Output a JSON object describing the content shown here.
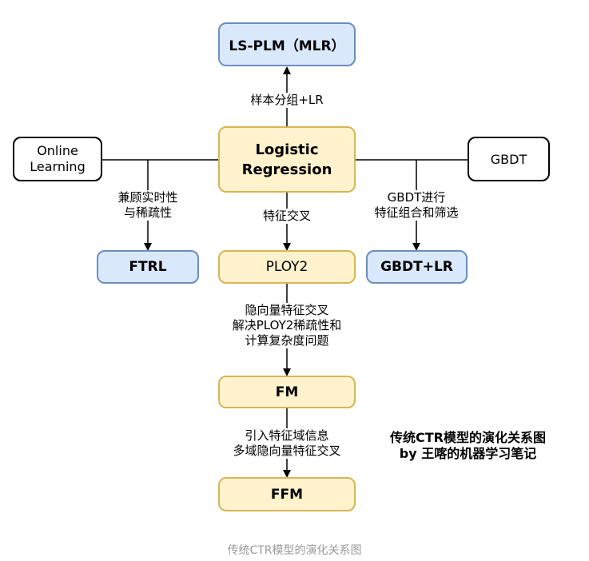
{
  "nodes": {
    "ls_plm": "LS-PLM（MLR）",
    "logistic": "Logistic\nRegression",
    "online_learning": "Online\nLearning",
    "gbdt": "GBDT",
    "ftrl": "FTRL",
    "ploy2": "PLOY2",
    "gbdt_lr": "GBDT+LR",
    "fm": "FM",
    "ffm": "FFM"
  },
  "edge_labels": {
    "to_ls_plm": "样本分组+LR",
    "to_ftrl": "兼顾实时性\n与稀疏性",
    "to_ploy2": "特征交叉",
    "to_gbdt_lr": "GBDT进行\n特征组合和筛选",
    "to_fm": "隐向量特征交叉\n解决PLOY2稀疏性和\n计算复杂度问题",
    "to_ffm": "引入特征域信息\n多域隐向量特征交叉"
  },
  "note": {
    "line1": "传统CTR模型的演化关系图",
    "line2": "by 王喀的机器学习笔记"
  },
  "caption": "传统CTR模型的演化关系图",
  "colors": {
    "blue_fill": "#dae8fc",
    "blue_stroke": "#6c8ebf",
    "yellow_fill": "#fff2cc",
    "yellow_stroke": "#d6b656"
  }
}
